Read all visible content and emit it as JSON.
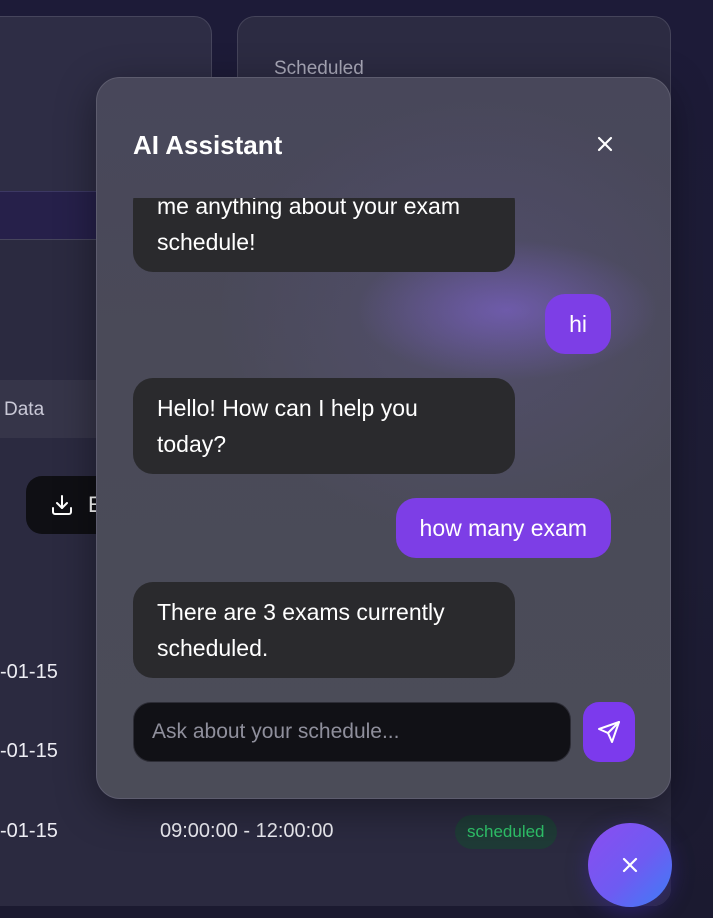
{
  "background": {
    "scheduled_label": "Scheduled",
    "data_tab_label": "Data",
    "export_button_label": "E",
    "rows": [
      {
        "date": "-01-15"
      },
      {
        "date": "-01-15"
      },
      {
        "date": "-01-15",
        "time": "09:00:00 - 12:00:00",
        "status": "scheduled"
      }
    ]
  },
  "chat": {
    "title": "AI Assistant",
    "close_icon": "close-icon",
    "messages": [
      {
        "role": "bot",
        "text": "me anything about your exam schedule!"
      },
      {
        "role": "user",
        "text": "hi"
      },
      {
        "role": "bot",
        "text": "Hello! How can I help you today?"
      },
      {
        "role": "user",
        "text": "how many exam"
      },
      {
        "role": "bot",
        "text": "There are 3 exams currently scheduled."
      }
    ],
    "input": {
      "value": "",
      "placeholder": "Ask about your schedule..."
    },
    "send_icon": "send-icon"
  },
  "fab": {
    "icon": "close-icon"
  },
  "colors": {
    "accent": "#7c3aed",
    "user_bubble": "#7d3ee6",
    "bot_bubble": "#2a2a2d",
    "status_green": "#2fc46a"
  }
}
